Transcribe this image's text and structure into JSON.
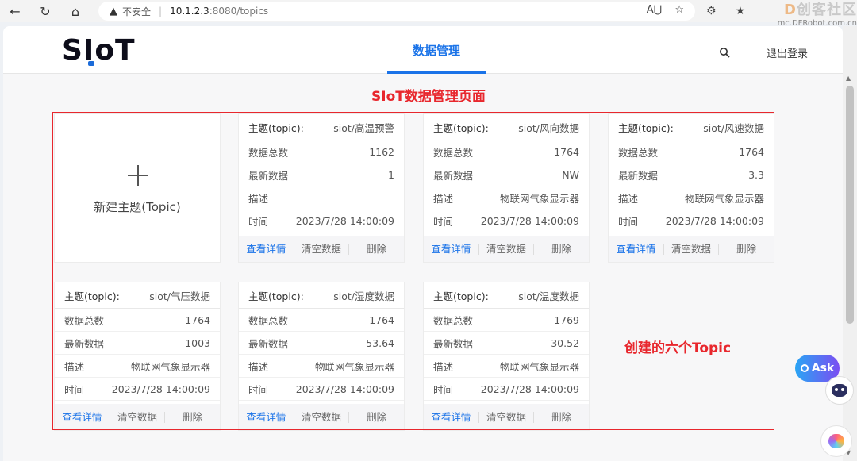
{
  "browser": {
    "security_icon": "warning-triangle-icon",
    "insecure_label": "不安全",
    "url_host": "10.1.2.3",
    "url_path": ":8080/topics"
  },
  "watermark": {
    "title_prefix": "D",
    "title": "创客社区",
    "subtitle": "mc.DFRobot.com.cn"
  },
  "header": {
    "logo": "SIoT",
    "nav_active": "数据管理",
    "logout": "退出登录"
  },
  "annotations": {
    "page_title": "SIoT数据管理页面",
    "note": "创建的六个Topic"
  },
  "new_topic": {
    "label": "新建主题(Topic)"
  },
  "labels": {
    "topic": "主题(topic):",
    "total": "数据总数",
    "latest": "最新数据",
    "desc": "描述",
    "time": "时间",
    "view": "查看详情",
    "clear": "清空数据",
    "delete": "删除"
  },
  "topics": [
    {
      "name": "siot/高温预警",
      "total": "1162",
      "latest": "1",
      "desc": "",
      "time": "2023/7/28 14:00:09"
    },
    {
      "name": "siot/风向数据",
      "total": "1764",
      "latest": "NW",
      "desc": "物联网气象显示器",
      "time": "2023/7/28 14:00:09"
    },
    {
      "name": "siot/风速数据",
      "total": "1764",
      "latest": "3.3",
      "desc": "物联网气象显示器",
      "time": "2023/7/28 14:00:09"
    },
    {
      "name": "siot/气压数据",
      "total": "1764",
      "latest": "1003",
      "desc": "物联网气象显示器",
      "time": "2023/7/28 14:00:09"
    },
    {
      "name": "siot/湿度数据",
      "total": "1764",
      "latest": "53.64",
      "desc": "物联网气象显示器",
      "time": "2023/7/28 14:00:09"
    },
    {
      "name": "siot/温度数据",
      "total": "1769",
      "latest": "30.52",
      "desc": "物联网气象显示器",
      "time": "2023/7/28 14:00:09"
    }
  ],
  "floating": {
    "ask_label": "Ask"
  }
}
